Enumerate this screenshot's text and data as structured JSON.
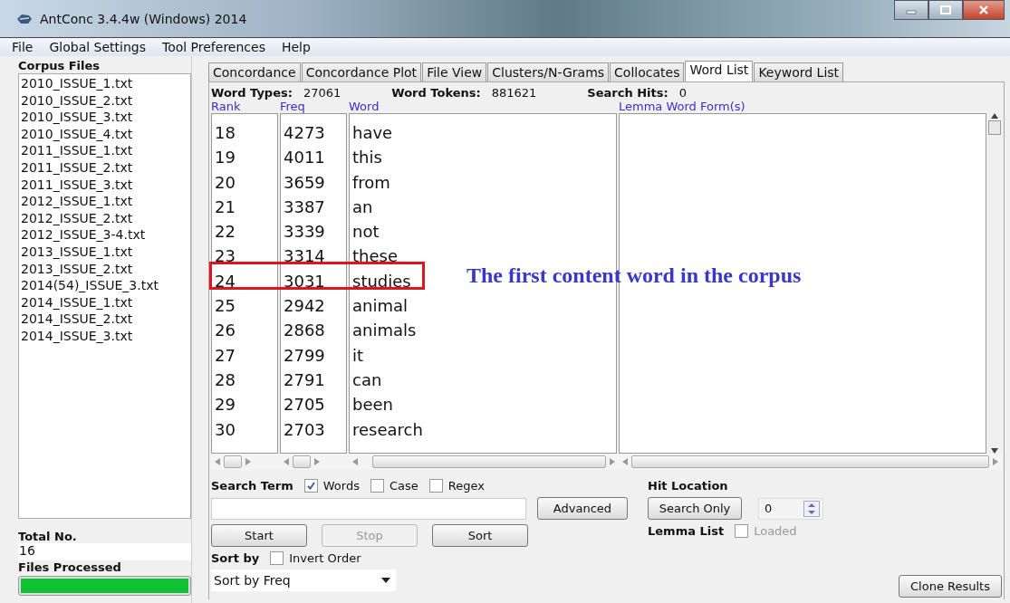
{
  "window": {
    "title": "AntConc 3.4.4w (Windows) 2014"
  },
  "menu": [
    "File",
    "Global Settings",
    "Tool Preferences",
    "Help"
  ],
  "corpus_files": {
    "heading": "Corpus Files",
    "files": [
      "2010_ISSUE_1.txt",
      "2010_ISSUE_2.txt",
      "2010_ISSUE_3.txt",
      "2010_ISSUE_4.txt",
      "2011_ISSUE_1.txt",
      "2011_ISSUE_2.txt",
      "2011_ISSUE_3.txt",
      "2012_ISSUE_1.txt",
      "2012_ISSUE_2.txt",
      "2012_ISSUE_3-4.txt",
      "2013_ISSUE_1.txt",
      "2013_ISSUE_2.txt",
      "2014(54)_ISSUE_3.txt",
      "2014_ISSUE_1.txt",
      "2014_ISSUE_2.txt",
      "2014_ISSUE_3.txt"
    ]
  },
  "total_no": {
    "label": "Total No.",
    "value": "16"
  },
  "files_processed": {
    "label": "Files Processed",
    "level": 1
  },
  "tabs": [
    {
      "label": "Concordance",
      "selected": false
    },
    {
      "label": "Concordance Plot",
      "selected": false
    },
    {
      "label": "File View",
      "selected": false
    },
    {
      "label": "Clusters/N-Grams",
      "selected": false
    },
    {
      "label": "Collocates",
      "selected": false
    },
    {
      "label": "Word List",
      "selected": true
    },
    {
      "label": "Keyword List",
      "selected": false
    }
  ],
  "stats": [
    {
      "label": "Word Types:",
      "value": "27061"
    },
    {
      "label": "Word Tokens:",
      "value": "881621"
    },
    {
      "label": "Search Hits:",
      "value": "0"
    }
  ],
  "columns": [
    "Rank",
    "Freq",
    "Word"
  ],
  "lemma_column": "Lemma Word Form(s)",
  "rows": [
    {
      "rank": "18",
      "freq": "4273",
      "word": "have",
      "marked": false
    },
    {
      "rank": "19",
      "freq": "4011",
      "word": "this",
      "marked": false
    },
    {
      "rank": "20",
      "freq": "3659",
      "word": "from",
      "marked": false
    },
    {
      "rank": "21",
      "freq": "3387",
      "word": "an",
      "marked": false
    },
    {
      "rank": "22",
      "freq": "3339",
      "word": "not",
      "marked": false
    },
    {
      "rank": "23",
      "freq": "3314",
      "word": "these",
      "marked": false
    },
    {
      "rank": "24",
      "freq": "3031",
      "word": "studies",
      "marked": true
    },
    {
      "rank": "25",
      "freq": "2942",
      "word": "animal",
      "marked": false
    },
    {
      "rank": "26",
      "freq": "2868",
      "word": "animals",
      "marked": false
    },
    {
      "rank": "27",
      "freq": "2799",
      "word": "it",
      "marked": false
    },
    {
      "rank": "28",
      "freq": "2791",
      "word": "can",
      "marked": false
    },
    {
      "rank": "29",
      "freq": "2705",
      "word": "been",
      "marked": false
    },
    {
      "rank": "30",
      "freq": "2703",
      "word": "research",
      "marked": false
    }
  ],
  "annotation": "The first content word in the corpus",
  "search_term": {
    "label": "Search Term",
    "options": [
      {
        "label": "Words",
        "checked": true
      },
      {
        "label": "Case",
        "checked": false
      },
      {
        "label": "Regex",
        "checked": false
      }
    ]
  },
  "advanced_button": "Advanced",
  "action_buttons": [
    {
      "label": "Start",
      "disabled": false
    },
    {
      "label": "Stop",
      "disabled": true
    },
    {
      "label": "Sort",
      "disabled": false
    }
  ],
  "sort_by": {
    "label": "Sort by",
    "invert": {
      "label": "Invert Order",
      "checked": false
    },
    "value": "Sort by Freq"
  },
  "hit_location": {
    "label": "Hit Location",
    "button": "Search Only",
    "value": "0"
  },
  "lemma_list": {
    "label": "Lemma List",
    "option": {
      "label": "Loaded",
      "checked": false,
      "disabled": true
    }
  },
  "clone_button": "Clone Results"
}
